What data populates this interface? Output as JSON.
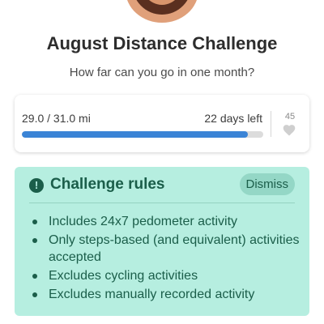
{
  "challenge": {
    "title": "August Distance Challenge",
    "subtitle": "How far can you go in one month?"
  },
  "progress": {
    "text": "29.0 / 31.0 mi",
    "days_left": "22 days left",
    "fraction": 0.935,
    "likes": "45",
    "bar_color": "#3b84d6"
  },
  "rules": {
    "icon": "info-icon",
    "title": "Challenge rules",
    "dismiss_label": "Dismiss",
    "items": [
      "Includes 24x7 pedometer activity",
      "Only steps-based (and equivalent) activities accepted",
      "Excludes cycling activities",
      "Excludes manually recorded activity"
    ],
    "accent": "#1b5e4a",
    "background": "#b6eee0"
  }
}
